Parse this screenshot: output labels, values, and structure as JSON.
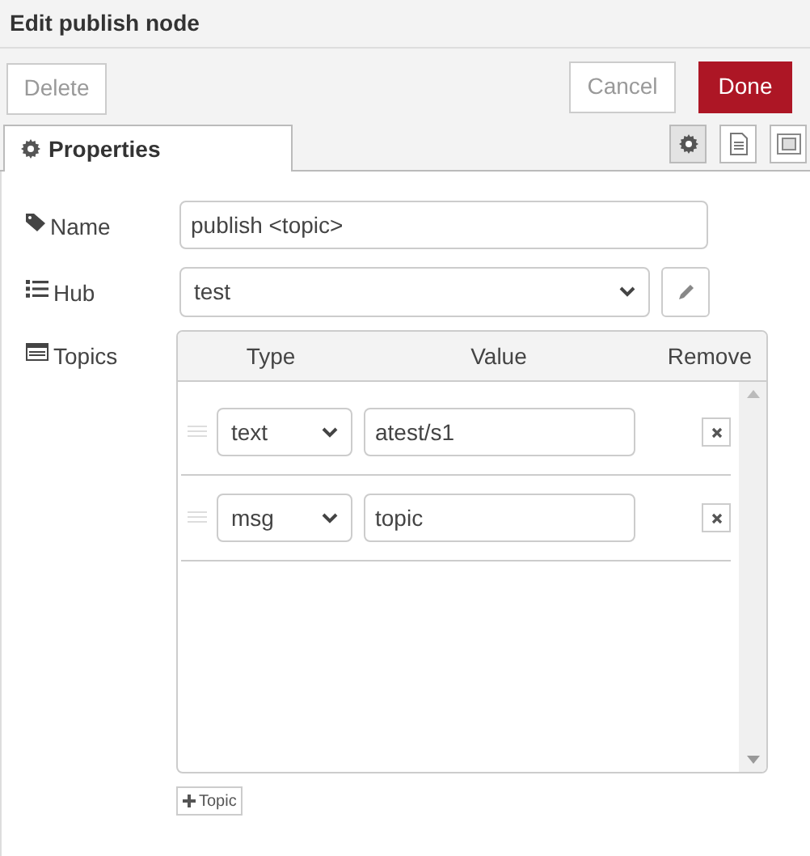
{
  "window": {
    "title": "Edit publish node"
  },
  "buttons": {
    "delete": "Delete",
    "cancel": "Cancel",
    "done": "Done"
  },
  "tabs": [
    {
      "label": "Properties",
      "selected": true
    }
  ],
  "side_tabs": [
    {
      "kind": "gear",
      "selected": true
    },
    {
      "kind": "document",
      "selected": false
    },
    {
      "kind": "frame",
      "selected": false
    }
  ],
  "form": {
    "name": {
      "label": "Name",
      "value": "publish <topic>"
    },
    "hub": {
      "label": "Hub",
      "value": "test"
    },
    "topics": {
      "label": "Topics",
      "columns": [
        "Type",
        "Value",
        "Remove"
      ],
      "rows": [
        {
          "type": "text",
          "value": "atest/s1"
        },
        {
          "type": "msg",
          "value": "topic"
        }
      ],
      "add_button": "Topic"
    }
  }
}
